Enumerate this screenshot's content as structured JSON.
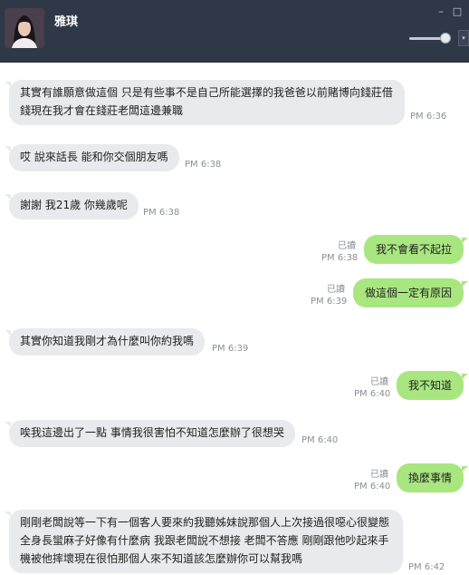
{
  "header": {
    "contact_name": "雅琪",
    "minimize_label": "–",
    "maximize_label": "□",
    "volume_level": 0.9,
    "volume_dropdown_label": "▾",
    "colors": {
      "background": "#2f3846",
      "text": "#ffffff"
    }
  },
  "colors": {
    "incoming_bubble": "#e8eaed",
    "outgoing_bubble": "#a9e680",
    "meta_text": "#8a8f96"
  },
  "messages": [
    {
      "direction": "incoming",
      "text_lines": [
        "其實有誰願意做這個 只是有些事不是自己所能選擇的我爸爸以前賭博向錢莊借",
        "錢現在我才會在錢莊老闆這邊兼職"
      ],
      "time": "PM 6:36"
    },
    {
      "direction": "incoming",
      "text": "哎 說來話長 能和你交個朋友嗎",
      "time": "PM 6:38"
    },
    {
      "direction": "incoming",
      "text": "謝謝 我21歲 你幾歲呢",
      "time": "PM 6:38"
    },
    {
      "direction": "outgoing",
      "text": "我不會看不起拉",
      "read": "已讀",
      "time": "PM 6:38"
    },
    {
      "direction": "outgoing",
      "text": "做這個一定有原因",
      "read": "已讀",
      "time": "PM 6:39"
    },
    {
      "direction": "incoming",
      "text": "其實你知道我剛才為什麼叫你約我嗎",
      "time": "PM 6:39"
    },
    {
      "direction": "outgoing",
      "text": "我不知道",
      "read": "已讀",
      "time": "PM 6:40"
    },
    {
      "direction": "incoming",
      "text": "唉我這邊出了一點 事情我很害怕不知道怎麼辦了很想哭",
      "time": "PM 6:40"
    },
    {
      "direction": "outgoing",
      "text": "換麼事情",
      "read": "已讀",
      "time": "PM 6:40"
    },
    {
      "direction": "incoming",
      "text_lines": [
        "剛剛老闆說等一下有一個客人要來約我聽姊妹說那個人上次接過很噁心很變態",
        "全身長蠻麻子好像有什麼病 我跟老闆說不想接  老闆不答應 剛剛跟他吵起來手",
        "機被他摔壞現在很怕那個人來不知道該怎麼辦你可以幫我嗎"
      ],
      "time": "PM 6:42"
    }
  ]
}
